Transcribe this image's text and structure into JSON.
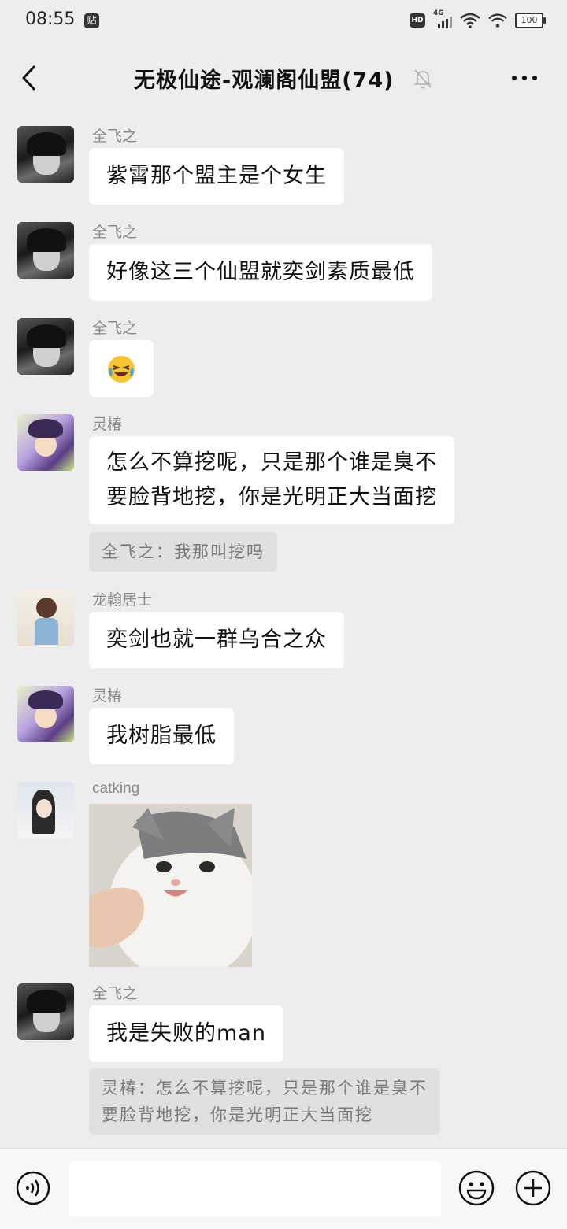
{
  "status_bar": {
    "time": "08:55",
    "tie_badge": "贴",
    "hd": "HD",
    "network": "4G",
    "battery": "100"
  },
  "header": {
    "title": "无极仙途-观澜阁仙盟(74)"
  },
  "messages": [
    {
      "sender": "全飞之",
      "text": "紫霄那个盟主是个女生"
    },
    {
      "sender": "全飞之",
      "text": "好像这三个仙盟就奕剑素质最低"
    },
    {
      "sender": "全飞之",
      "emoji": "grinning-squinting-tears-emoji"
    },
    {
      "sender": "灵椿",
      "text": "怎么不算挖呢，只是那个谁是臭不\n要脸背地挖，你是光明正大当面挖",
      "quote": "全飞之：我那叫挖吗"
    },
    {
      "sender": "龙翰居士",
      "text": "奕剑也就一群乌合之众"
    },
    {
      "sender": "灵椿",
      "text": "我树脂最低"
    },
    {
      "sender": "catking",
      "image": "cat-photo"
    },
    {
      "sender": "全飞之",
      "text": "我是失败的man",
      "quote": "灵椿：怎么不算挖呢，只是那个谁是臭不\n要脸背地挖，你是光明正大当面挖"
    }
  ],
  "colors": {
    "background": "#ededed",
    "bubble": "#ffffff",
    "quote": "#e0e0e0",
    "sender": "#8a8a8a"
  }
}
